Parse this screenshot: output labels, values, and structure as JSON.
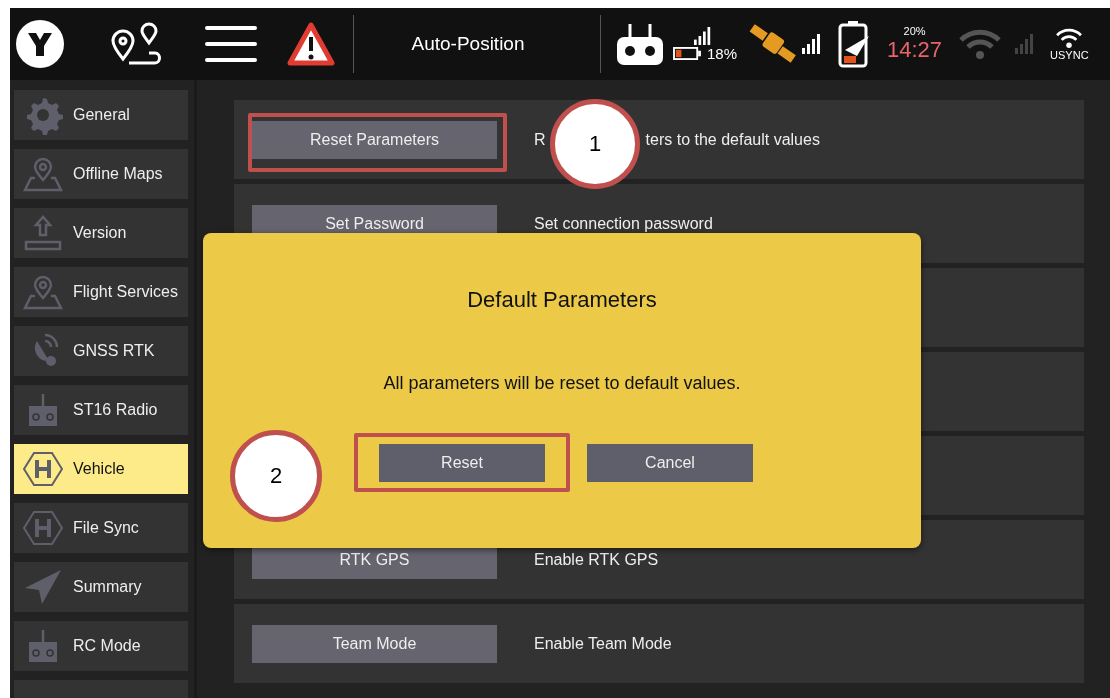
{
  "top_bar": {
    "mode": "Auto-Position",
    "rc_battery": "18%",
    "aircraft_battery": "20%",
    "time": "14:27",
    "network": "USYNC"
  },
  "sidebar": {
    "items": [
      {
        "label": "General",
        "kind": "gear",
        "selected": false
      },
      {
        "label": "Offline Maps",
        "kind": "map",
        "selected": false
      },
      {
        "label": "Version",
        "kind": "upload",
        "selected": false
      },
      {
        "label": "Flight Services",
        "kind": "map",
        "selected": false
      },
      {
        "label": "GNSS RTK",
        "kind": "gnss",
        "selected": false
      },
      {
        "label": "ST16 Radio",
        "kind": "radio",
        "selected": false
      },
      {
        "label": "Vehicle",
        "kind": "heli",
        "selected": true
      },
      {
        "label": "File Sync",
        "kind": "heli",
        "selected": false
      },
      {
        "label": "Summary",
        "kind": "plane",
        "selected": false
      },
      {
        "label": "RC Mode",
        "kind": "radio",
        "selected": false
      }
    ]
  },
  "settings": [
    {
      "kind": "option",
      "button": "Reset Parameters",
      "description": [
        "R",
        "ters to the default values"
      ],
      "highlighted": true
    },
    {
      "kind": "option",
      "button": "Set Password",
      "description": [
        "Set connection password"
      ],
      "highlighted": false
    },
    {
      "kind": "covered"
    },
    {
      "kind": "covered"
    },
    {
      "kind": "covered"
    },
    {
      "kind": "option",
      "button": "RTK GPS",
      "description": [
        "Enable RTK GPS"
      ],
      "highlighted": false
    },
    {
      "kind": "option",
      "button": "Team Mode",
      "description": [
        "Enable Team Mode"
      ],
      "highlighted": false
    }
  ],
  "dialog": {
    "title": "Default Parameters",
    "message": "All parameters will be reset to default values.",
    "buttons": [
      {
        "label": "Reset",
        "highlighted": true
      },
      {
        "label": "Cancel",
        "highlighted": false
      }
    ]
  },
  "callouts": [
    "1",
    "2"
  ]
}
